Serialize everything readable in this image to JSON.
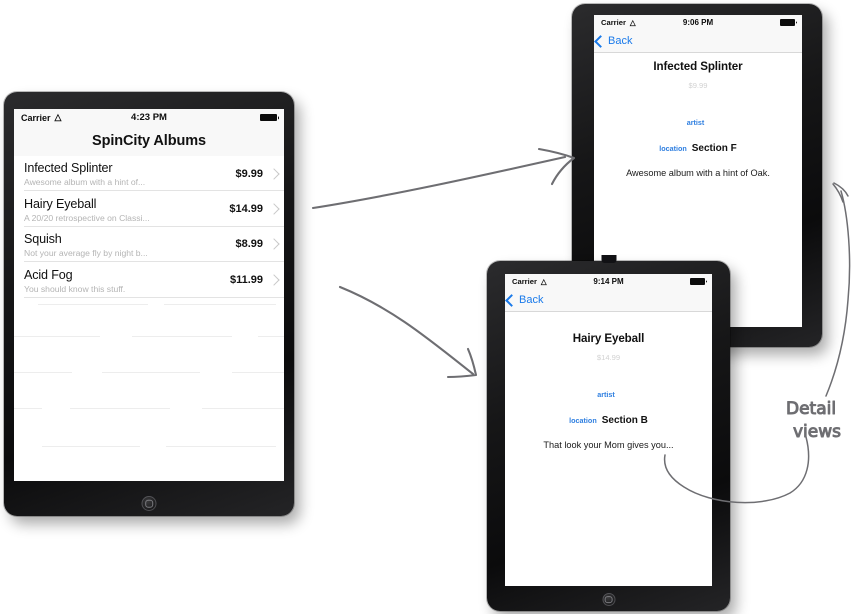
{
  "ipad": {
    "device_name": "ipad-tablet",
    "status_bar": {
      "carrier": "Carrier",
      "wifi_icon": "wifi-icon",
      "time": "4:23 PM",
      "battery_icon": "battery-full-icon"
    },
    "nav_title": "SpinCity Albums",
    "list": {
      "rows": [
        {
          "title": "Infected Splinter",
          "subtitle": "Awesome album with a hint of...",
          "price": "$9.99",
          "accessory": "disclosure-chevron-icon"
        },
        {
          "title": "Hairy Eyeball",
          "subtitle": "A 20/20 retrospective on Classi...",
          "price": "$14.99",
          "accessory": "disclosure-chevron-icon"
        },
        {
          "title": "Squish",
          "subtitle": "Not your average fly by night b...",
          "price": "$8.99",
          "accessory": "disclosure-chevron-icon"
        },
        {
          "title": "Acid Fog",
          "subtitle": "You should know this stuff.",
          "price": "$11.99",
          "accessory": "disclosure-chevron-icon"
        }
      ]
    }
  },
  "phone1": {
    "device_name": "iphone-detail-infected-splinter",
    "status_bar": {
      "carrier": "Carrier",
      "wifi_icon": "wifi-icon",
      "time": "9:06 PM",
      "battery_icon": "battery-full-icon"
    },
    "back_label": "Back",
    "detail": {
      "title": "Infected Splinter",
      "price": "$9.99",
      "artist_label": "artist",
      "artist_value": "",
      "location_label": "location",
      "location_value": "Section F",
      "description": "Awesome album with a hint of Oak."
    }
  },
  "phone2": {
    "device_name": "iphone-detail-hairy-eyeball",
    "status_bar": {
      "carrier": "Carrier",
      "wifi_icon": "wifi-icon",
      "time": "9:14 PM",
      "battery_icon": "battery-full-icon"
    },
    "back_label": "Back",
    "detail": {
      "title": "Hairy Eyeball",
      "price": "$14.99",
      "artist_label": "artist",
      "artist_value": "",
      "location_label": "location",
      "location_value": "Section B",
      "description": "That look your Mom gives you..."
    }
  },
  "annotations": {
    "detail_views": "Detail\nviews"
  },
  "colors": {
    "ios_blue": "#1a7aea",
    "label_blue": "#2f7fe0",
    "navbar_bg": "#f8f8f8",
    "annotation_gray": "#6e6e72",
    "subtitle_gray": "#b4b4b4"
  }
}
